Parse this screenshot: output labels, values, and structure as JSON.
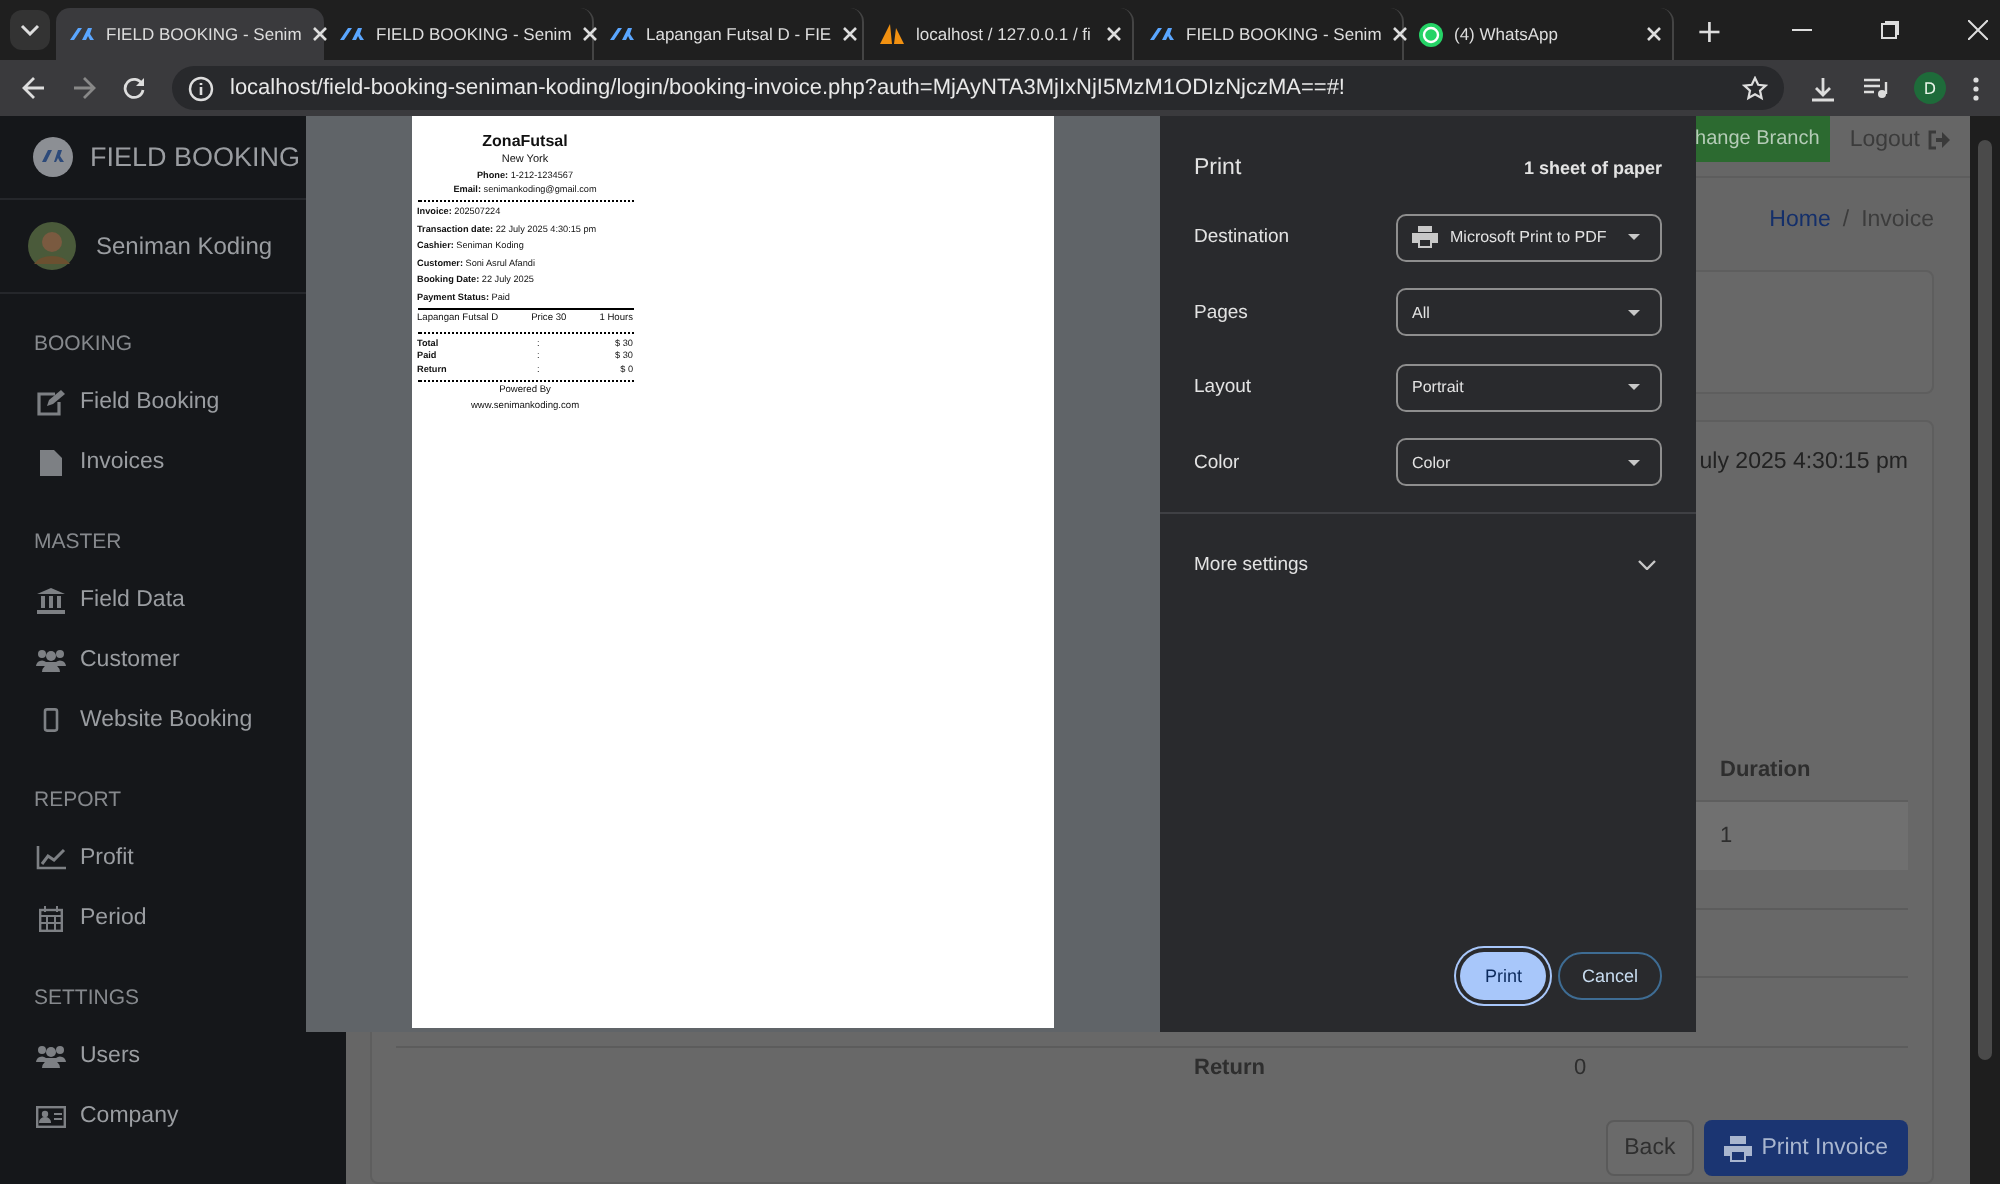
{
  "browser": {
    "tabs": [
      {
        "title": "FIELD BOOKING - Senim",
        "kind": "sk",
        "selected": true
      },
      {
        "title": "FIELD BOOKING - Senim",
        "kind": "sk",
        "selected": false
      },
      {
        "title": "Lapangan Futsal D - FIE",
        "kind": "sk",
        "selected": false
      },
      {
        "title": "localhost / 127.0.0.1 / fi",
        "kind": "sail",
        "selected": false
      },
      {
        "title": "FIELD BOOKING - Senim",
        "kind": "sk",
        "selected": false
      },
      {
        "title": "(4) WhatsApp",
        "kind": "chat",
        "selected": false
      }
    ],
    "new_tab": "+",
    "url": "localhost/field-booking-seniman-koding/login/booking-invoice.php?auth=MjAyNTA3MjIxNjI5MzM1ODIzNjczMA==#!",
    "profile": "D"
  },
  "sidebar": {
    "brand": "FIELD BOOKING",
    "user": "Seniman Koding",
    "sections": [
      {
        "title": "BOOKING",
        "items": [
          {
            "label": "Field Booking",
            "kind": "edit"
          },
          {
            "label": "Invoices",
            "kind": "file"
          }
        ]
      },
      {
        "title": "MASTER",
        "items": [
          {
            "label": "Field Data",
            "kind": "bank"
          },
          {
            "label": "Customer",
            "kind": "users"
          },
          {
            "label": "Website Booking",
            "kind": "mobile"
          }
        ]
      },
      {
        "title": "REPORT",
        "items": [
          {
            "label": "Profit",
            "kind": "chart"
          },
          {
            "label": "Period",
            "kind": "calendar"
          }
        ]
      },
      {
        "title": "SETTINGS",
        "items": [
          {
            "label": "Users",
            "kind": "users"
          },
          {
            "label": "Company",
            "kind": "card"
          }
        ]
      }
    ]
  },
  "page": {
    "change_branch": "hange Branch",
    "logout": "Logout",
    "breadcrumb": [
      "Home",
      "Invoice"
    ],
    "breadcrumb_separator": "/",
    "date_fragment": "uly 2025 4:30:15 pm",
    "table": {
      "column": "Duration",
      "cell": "1"
    },
    "summary": {
      "label": "Return",
      "value": "0"
    },
    "buttons": {
      "back": "Back",
      "print": "Print Invoice"
    }
  },
  "print_dialog": {
    "title": "Print",
    "sheets": "1 sheet of paper",
    "settings": [
      {
        "label": "Destination",
        "value": "Microsoft Print to PDF",
        "kind": "printer"
      },
      {
        "label": "Pages",
        "value": "All",
        "kind": "plain"
      },
      {
        "label": "Layout",
        "value": "Portrait",
        "kind": "plain"
      },
      {
        "label": "Color",
        "value": "Color",
        "kind": "plain"
      }
    ],
    "more_settings": "More settings",
    "print": "Print",
    "cancel": "Cancel",
    "receipt": {
      "store": "ZonaFutsal",
      "city": "New York",
      "contacts": [
        "**Phone:** 1-212-1234567",
        "**Email:** senimankoding@gmail.com"
      ],
      "details": [
        "**Invoice:** 202507224",
        "**Transaction date:** 22 July 2025 4:30:15 pm",
        "**Cashier:** Seniman Koding",
        "**Customer:** Soni Asrul Afandi",
        "**Booking Date:** 22 July 2025",
        "**Payment Status:** Paid"
      ],
      "item": [
        "Lapangan Futsal D",
        "Price 30",
        "1 Hours"
      ],
      "totals": [
        {
          "label": "Total",
          "sep": ":",
          "value": "$ 30"
        },
        {
          "label": "Paid",
          "sep": ":",
          "value": "$ 30"
        },
        {
          "label": "Return",
          "sep": ":",
          "value": "$ 0"
        }
      ],
      "footer": [
        "Powered By",
        "www.senimankoding.com"
      ]
    }
  }
}
